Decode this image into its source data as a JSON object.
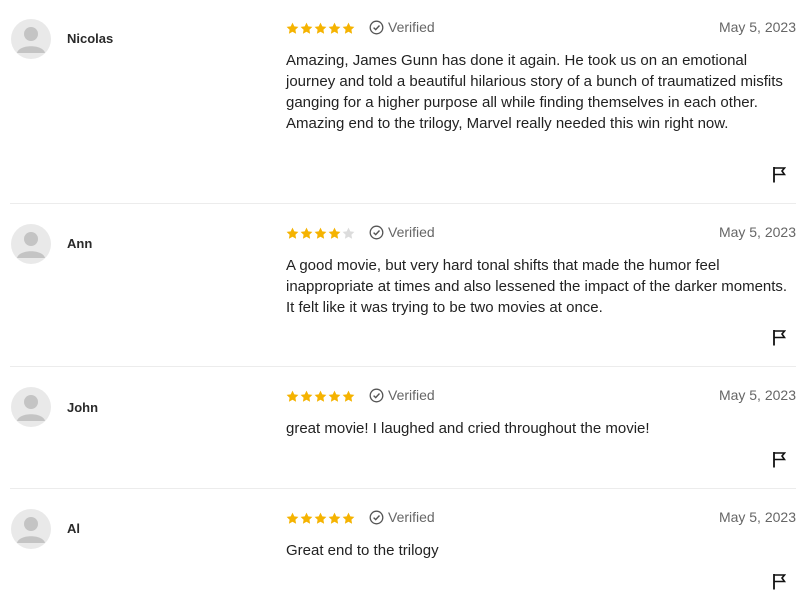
{
  "reviews": [
    {
      "author": "Nicolas",
      "rating": 5,
      "max_rating": 5,
      "verified_label": "Verified",
      "date": "May 5, 2023",
      "text": "Amazing, James Gunn has done it again. He took us on an emotional journey and told a beautiful hilarious story of a bunch of traumatized misfits ganging for a higher purpose all while finding themselves in each other. Amazing end to the trilogy, Marvel really needed this win right now."
    },
    {
      "author": "Ann",
      "rating": 4,
      "max_rating": 5,
      "verified_label": "Verified",
      "date": "May 5, 2023",
      "text": "A good movie, but very hard tonal shifts that made the humor feel inappropriate at times and also lessened the impact of the darker moments. It felt like it was trying to be two movies at once."
    },
    {
      "author": "John",
      "rating": 5,
      "max_rating": 5,
      "verified_label": "Verified",
      "date": "May 5, 2023",
      "text": "great movie! I laughed and cried throughout the movie!"
    },
    {
      "author": "Al",
      "rating": 5,
      "max_rating": 5,
      "verified_label": "Verified",
      "date": "May 5, 2023",
      "text": "Great end to the trilogy"
    }
  ],
  "colors": {
    "star_filled": "#f5b301",
    "star_empty": "#dcdcdc",
    "avatar_bg": "#e9e9e9",
    "avatar_fg": "#c4c4c4",
    "muted_text": "#666666",
    "divider": "#ececec"
  },
  "icons": {
    "avatar": "user-silhouette-icon",
    "star": "star-icon",
    "verified": "check-circle-icon",
    "flag": "flag-icon"
  }
}
